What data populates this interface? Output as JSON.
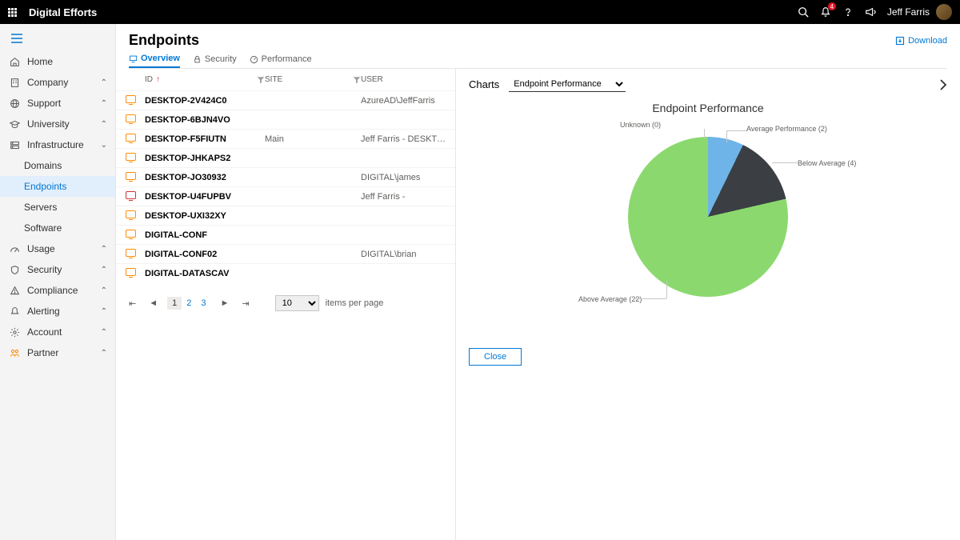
{
  "topbar": {
    "brand": "Digital Efforts",
    "notif_count": "4",
    "username": "Jeff Farris"
  },
  "sidebar": {
    "items": [
      {
        "label": "Home",
        "icon": "home",
        "chev": false
      },
      {
        "label": "Company",
        "icon": "building",
        "chev": true
      },
      {
        "label": "Support",
        "icon": "globe",
        "chev": true
      },
      {
        "label": "University",
        "icon": "grad",
        "chev": true
      },
      {
        "label": "Infrastructure",
        "icon": "server",
        "chev": true,
        "expanded": true
      },
      {
        "label": "Domains",
        "sub": true
      },
      {
        "label": "Endpoints",
        "sub": true,
        "active": true
      },
      {
        "label": "Servers",
        "sub": true
      },
      {
        "label": "Software",
        "sub": true
      },
      {
        "label": "Usage",
        "icon": "gauge",
        "chev": true
      },
      {
        "label": "Security",
        "icon": "shield",
        "chev": true
      },
      {
        "label": "Compliance",
        "icon": "warn",
        "chev": true
      },
      {
        "label": "Alerting",
        "icon": "bell",
        "chev": true
      },
      {
        "label": "Account",
        "icon": "gear",
        "chev": true
      },
      {
        "label": "Partner",
        "icon": "partner",
        "chev": true,
        "accent": true
      }
    ]
  },
  "page": {
    "title": "Endpoints",
    "download": "Download",
    "tabs": [
      {
        "label": "Overview",
        "icon": "monitor",
        "active": true
      },
      {
        "label": "Security",
        "icon": "lock"
      },
      {
        "label": "Performance",
        "icon": "speed"
      }
    ]
  },
  "table": {
    "headers": {
      "id": "ID",
      "site": "SITE",
      "user": "USER"
    },
    "rows": [
      {
        "id": "DESKTOP-2V424C0",
        "site": "",
        "user": "AzureAD\\JeffFarris",
        "color": "orange"
      },
      {
        "id": "DESKTOP-6BJN4VO",
        "site": "",
        "user": "",
        "color": "orange"
      },
      {
        "id": "DESKTOP-F5FIUTN",
        "site": "Main",
        "user": "Jeff Farris - DESKTOP-F5FIUTN",
        "color": "orange"
      },
      {
        "id": "DESKTOP-JHKAPS2",
        "site": "",
        "user": "",
        "color": "orange"
      },
      {
        "id": "DESKTOP-JO30932",
        "site": "",
        "user": "DIGITAL\\james",
        "color": "orange"
      },
      {
        "id": "DESKTOP-U4FUPBV",
        "site": "",
        "user": "Jeff Farris -",
        "color": "red"
      },
      {
        "id": "DESKTOP-UXI32XY",
        "site": "",
        "user": "",
        "color": "orange"
      },
      {
        "id": "DIGITAL-CONF",
        "site": "",
        "user": "",
        "color": "orange"
      },
      {
        "id": "DIGITAL-CONF02",
        "site": "",
        "user": "DIGITAL\\brian",
        "color": "orange"
      },
      {
        "id": "DIGITAL-DATASCAV",
        "site": "",
        "user": "",
        "color": "orange"
      }
    ],
    "pager": {
      "pages": [
        "1",
        "2",
        "3"
      ],
      "current": "1",
      "page_size": "10",
      "per_page_label": "items per page"
    }
  },
  "charts": {
    "panel_label": "Charts",
    "dropdown": "Endpoint Performance",
    "title": "Endpoint Performance",
    "close": "Close",
    "labels": {
      "unknown": "Unknown (0)",
      "average": "Average Performance (2)",
      "below": "Below Average (4)",
      "above": "Above Average (22)"
    }
  },
  "chart_data": {
    "type": "pie",
    "title": "Endpoint Performance",
    "series": [
      {
        "name": "Unknown",
        "value": 0,
        "color": "#cccccc"
      },
      {
        "name": "Average Performance",
        "value": 2,
        "color": "#6eb4e8"
      },
      {
        "name": "Below Average",
        "value": 4,
        "color": "#3b3f44"
      },
      {
        "name": "Above Average",
        "value": 22,
        "color": "#8bd96e"
      }
    ]
  }
}
